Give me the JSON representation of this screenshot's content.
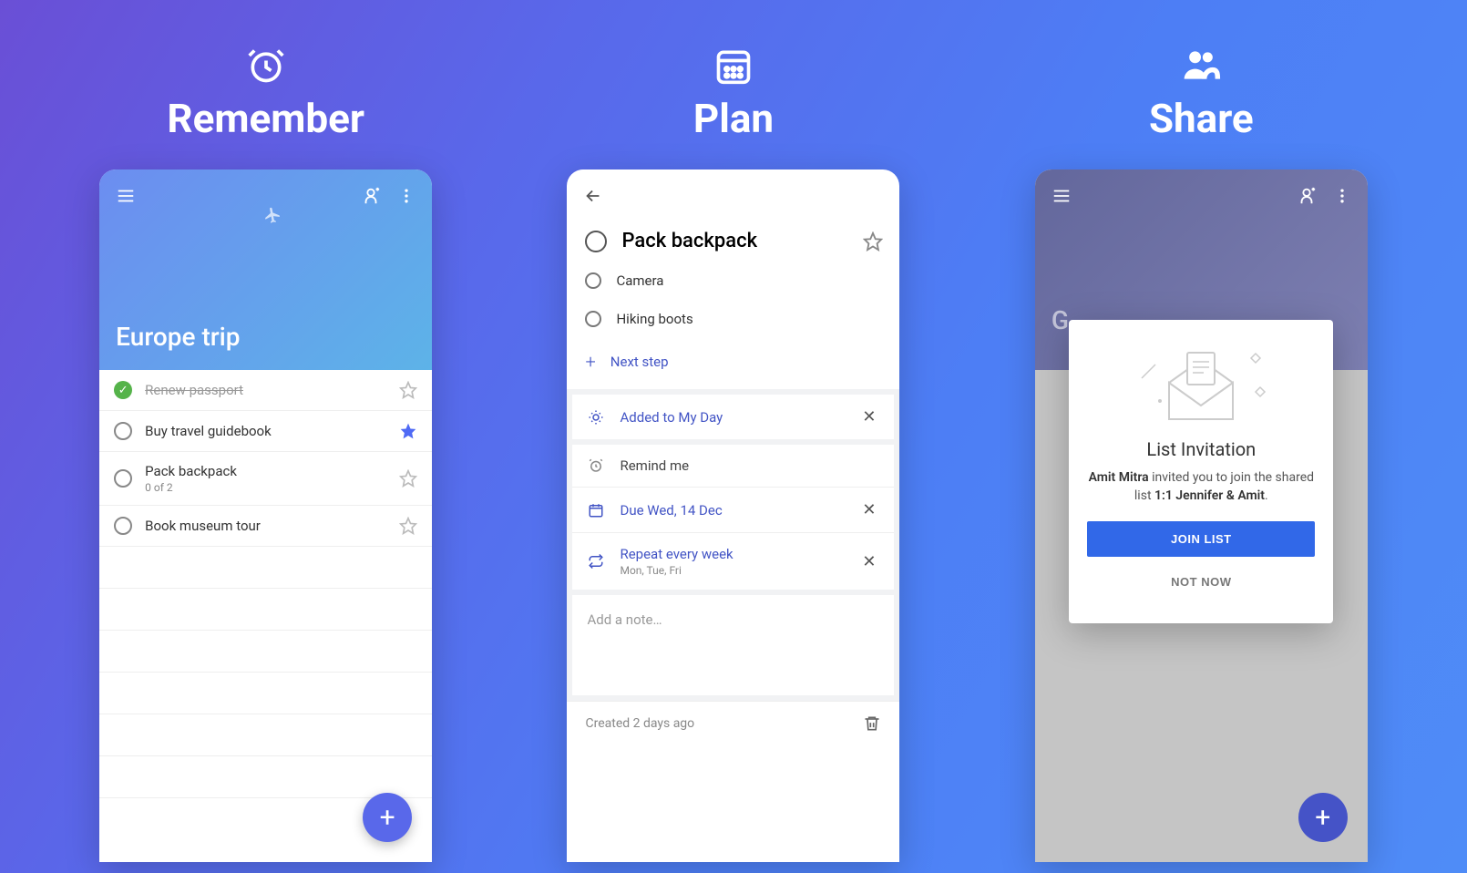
{
  "columns": [
    {
      "title": "Remember"
    },
    {
      "title": "Plan"
    },
    {
      "title": "Share"
    }
  ],
  "p1": {
    "list_title": "Europe trip",
    "tasks": [
      {
        "text": "Renew passport",
        "done": true,
        "starred": false
      },
      {
        "text": "Buy travel guidebook",
        "done": false,
        "starred": true
      },
      {
        "text": "Pack backpack",
        "sub": "0 of 2",
        "done": false,
        "starred": false
      },
      {
        "text": "Book museum tour",
        "done": false,
        "starred": false
      }
    ]
  },
  "p2": {
    "task_title": "Pack backpack",
    "subtasks": [
      {
        "text": "Camera"
      },
      {
        "text": "Hiking boots"
      }
    ],
    "next_step_label": "Next step",
    "myday_label": "Added to My Day",
    "remind_label": "Remind me",
    "due_label": "Due Wed, 14 Dec",
    "repeat_label": "Repeat every week",
    "repeat_sub": "Mon, Tue, Fri",
    "note_placeholder": "Add a note…",
    "footer_created": "Created 2 days ago"
  },
  "p3": {
    "list_title_partial": "G",
    "modal": {
      "title": "List Invitation",
      "inviter": "Amit Mitra",
      "invite_middle": " invited you to join the shared list ",
      "list_name": "1:1 Jennifer & Amit",
      "join_label": "JOIN LIST",
      "decline_label": "NOT NOW"
    }
  }
}
